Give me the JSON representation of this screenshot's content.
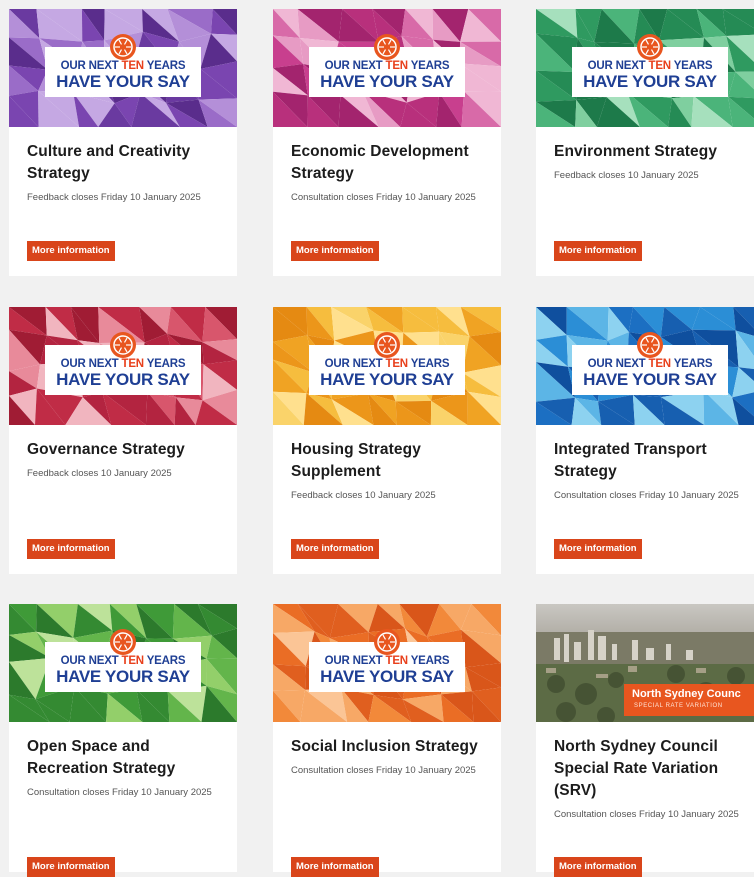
{
  "banner_text": {
    "line1_a": "OUR NEXT ",
    "line1_ten": "TEN",
    "line1_b": " YEARS",
    "line2": "HAVE YOUR SAY"
  },
  "button_label": "More information",
  "cards": [
    {
      "title": "Culture and Creativity Strategy",
      "subtitle": "Feedback closes Friday 10 January 2025",
      "palette": [
        "#5a2d8c",
        "#7a45b0",
        "#9a6cc8",
        "#b48fd8",
        "#6a3aa0",
        "#c5a8e3"
      ]
    },
    {
      "title": "Economic Development Strategy",
      "subtitle": "Consultation closes Friday 10 January 2025",
      "palette": [
        "#a3246e",
        "#c83f8e",
        "#d86aa8",
        "#e79bc4",
        "#b8307c",
        "#f0b7d4"
      ]
    },
    {
      "title": "Environment Strategy",
      "subtitle": "Feedback closes 10 January 2025",
      "palette": [
        "#1d7a4a",
        "#2f9a60",
        "#4bb47a",
        "#7fcf9f",
        "#258b55",
        "#a6e0bd"
      ]
    },
    {
      "title": "Governance Strategy",
      "subtitle": "Feedback closes 10 January 2025",
      "palette": [
        "#a01c34",
        "#c02c46",
        "#d8566c",
        "#e88a9a",
        "#b32440",
        "#f1b5bf"
      ]
    },
    {
      "title": "Housing Strategy Supplement",
      "subtitle": "Feedback closes 10 January 2025",
      "palette": [
        "#e58a12",
        "#f0a323",
        "#f6bd3e",
        "#fad36a",
        "#ec961a",
        "#ffe08e"
      ]
    },
    {
      "title": "Integrated Transport Strategy",
      "subtitle": "Consultation closes Friday 10 January 2025",
      "palette": [
        "#0f4f9e",
        "#1c6fc2",
        "#2b8ed6",
        "#5cb5e6",
        "#175fb0",
        "#8dd2f0"
      ]
    },
    {
      "title": "Open Space and Recreation Strategy",
      "subtitle": "Consultation closes Friday 10 January 2025",
      "palette": [
        "#2c7a2c",
        "#3f9a38",
        "#63b54b",
        "#93cf6a",
        "#348a32",
        "#bde29a"
      ]
    },
    {
      "title": "Social Inclusion Strategy",
      "subtitle": "Consultation closes Friday 10 January 2025",
      "palette": [
        "#d9561a",
        "#ea6d25",
        "#f2893a",
        "#f7a866",
        "#e05f1f",
        "#fbc596"
      ]
    },
    {
      "title": "North Sydney Council Special Rate Variation (SRV)",
      "subtitle": "Consultation closes Friday 10 January 2025",
      "photo": true,
      "tag_title": "North Sydney Counc",
      "tag_sub": "SPECIAL RATE VARIATION"
    }
  ],
  "colors": {
    "accent": "#d9451a",
    "banner_text_blue": "#1f3f94",
    "banner_text_orange": "#e8401c",
    "page_bg": "#f1f1f1"
  }
}
